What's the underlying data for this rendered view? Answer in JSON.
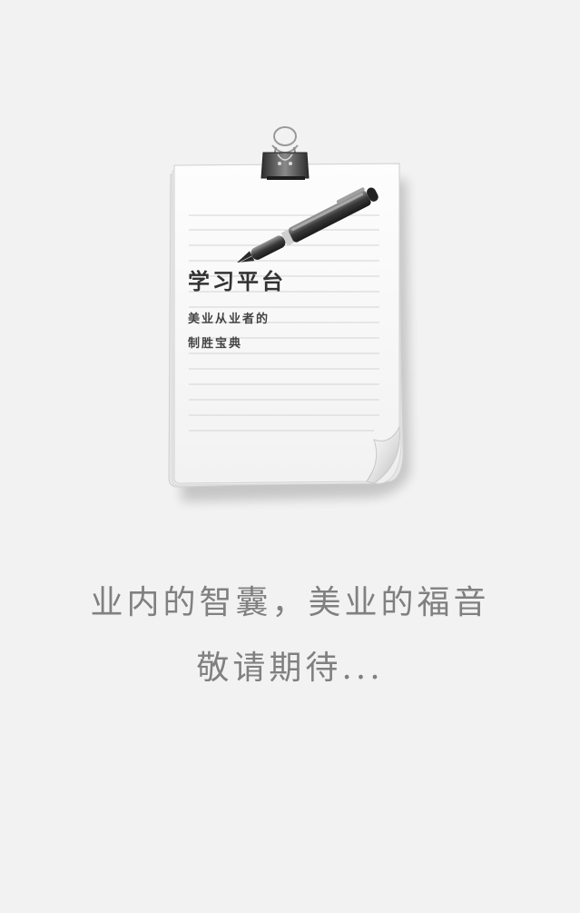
{
  "note": {
    "title": "学习平台",
    "line1": "美业从业者的",
    "line2": "制胜宝典"
  },
  "tagline": {
    "line1": "业内的智囊，美业的福音",
    "line2": "敬请期待..."
  },
  "colors": {
    "background": "#f2f2f2",
    "paper": "#fbfbfb",
    "tagline_text": "#808080"
  },
  "icons": {
    "clip": "binder-clip-icon",
    "pen": "fountain-pen-icon"
  }
}
